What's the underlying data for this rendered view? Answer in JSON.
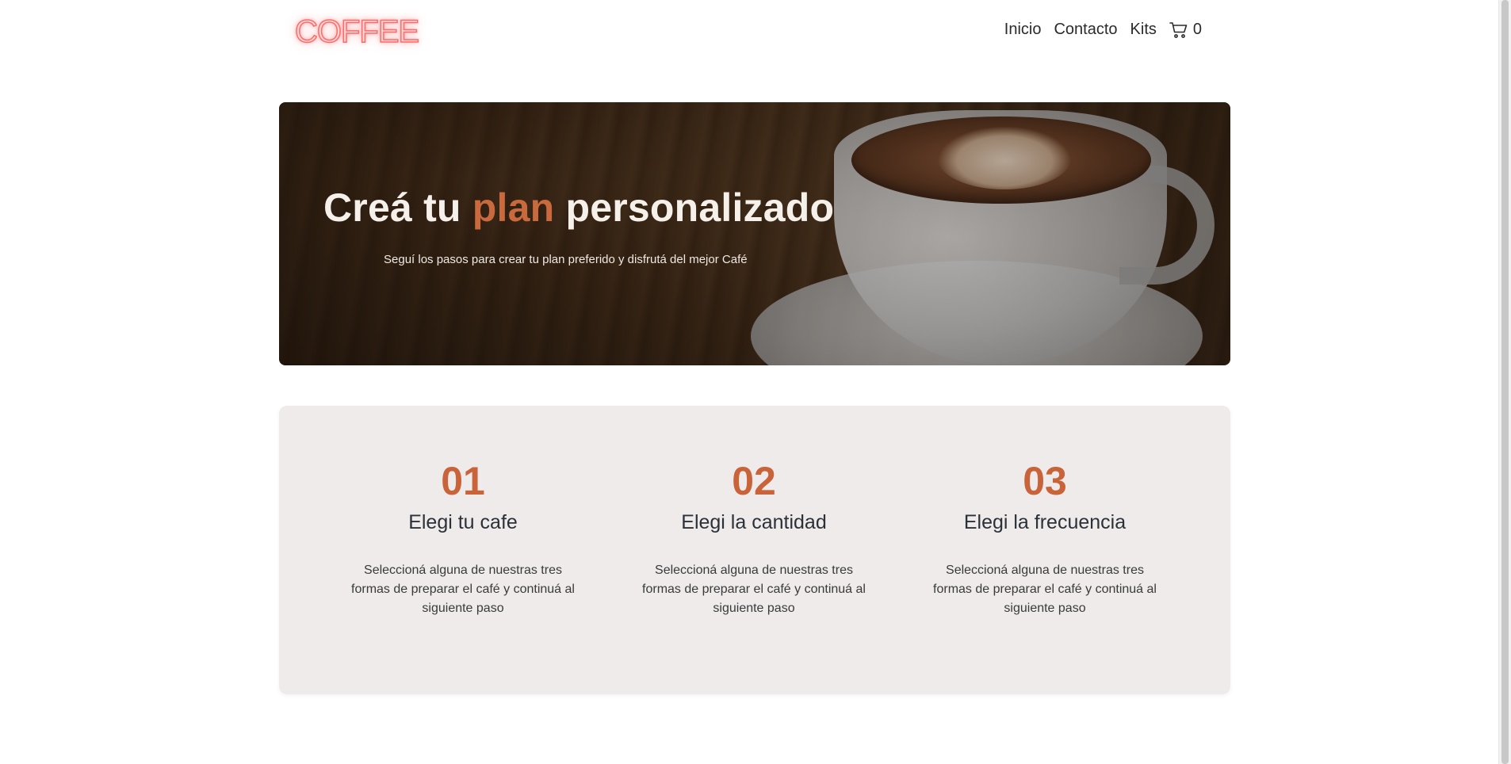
{
  "header": {
    "logo": "COFFEE",
    "nav": [
      {
        "label": "Inicio"
      },
      {
        "label": "Contacto"
      },
      {
        "label": "Kits"
      }
    ],
    "cart_count": "0"
  },
  "hero": {
    "title_part1": "Creá tu",
    "title_accent": "plan",
    "title_part2": "personalizado",
    "subtitle": "Seguí los pasos para crear tu plan preferido y disfrutá del mejor Café"
  },
  "steps": [
    {
      "number": "01",
      "title": "Elegi tu cafe",
      "description": "Seleccioná alguna de nuestras tres formas de preparar el café y continuá al siguiente paso"
    },
    {
      "number": "02",
      "title": "Elegi la cantidad",
      "description": "Seleccioná alguna de nuestras tres formas de preparar el café y continuá al siguiente paso"
    },
    {
      "number": "03",
      "title": "Elegi la frecuencia",
      "description": "Seleccioná alguna de nuestras tres formas de preparar el café y continuá al siguiente paso"
    }
  ],
  "colors": {
    "accent": "#c8633a",
    "section_bg": "#efebea",
    "logo_neon": "#ff6b6b"
  }
}
